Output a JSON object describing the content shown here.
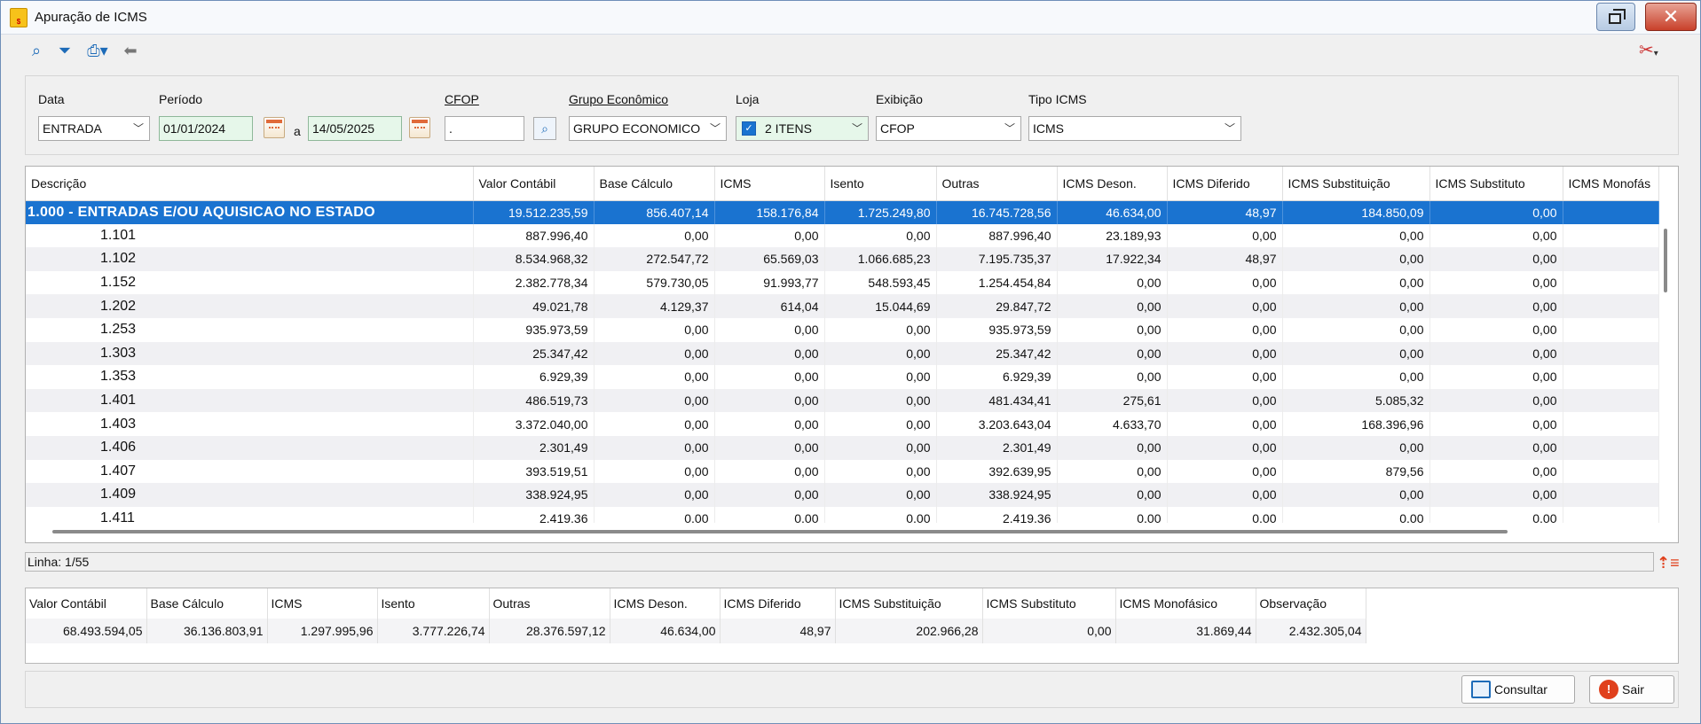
{
  "window": {
    "title": "Apuração de ICMS",
    "app_icon": "icms-app-icon",
    "restore_icon": "restore-icon",
    "close_icon": "close-icon"
  },
  "toolbar": {
    "icons": [
      "search-icon",
      "filter-icon",
      "print-icon",
      "back-arrow-icon"
    ],
    "tools_icon": "tools-icon"
  },
  "filters": {
    "data": {
      "label": "Data",
      "value": "ENTRADA"
    },
    "periodo": {
      "label": "Período",
      "start": "01/01/2024",
      "between": "a",
      "end": "14/05/2025"
    },
    "cfop": {
      "label": "CFOP",
      "value": "."
    },
    "grupo": {
      "label": "Grupo Econômico",
      "value": "GRUPO ECONOMICO"
    },
    "loja": {
      "label": "Loja",
      "value": "2 ITENS"
    },
    "exibicao": {
      "label": "Exibição",
      "value": "CFOP"
    },
    "tipo_icms": {
      "label": "Tipo ICMS",
      "value": "ICMS"
    }
  },
  "grid": {
    "columns": [
      "Descrição",
      "Valor Contábil",
      "Base Cálculo",
      "ICMS",
      "Isento",
      "Outras",
      "ICMS Deson.",
      "ICMS Diferido",
      "ICMS Substituição",
      "ICMS Substituto",
      "ICMS Monofás"
    ],
    "rows": [
      [
        "1.000 - ENTRADAS E/OU AQUISICAO NO ESTADO",
        "19.512.235,59",
        "856.407,14",
        "158.176,84",
        "1.725.249,80",
        "16.745.728,56",
        "46.634,00",
        "48,97",
        "184.850,09",
        "0,00",
        ""
      ],
      [
        "1.101",
        "887.996,40",
        "0,00",
        "0,00",
        "0,00",
        "887.996,40",
        "23.189,93",
        "0,00",
        "0,00",
        "0,00",
        ""
      ],
      [
        "1.102",
        "8.534.968,32",
        "272.547,72",
        "65.569,03",
        "1.066.685,23",
        "7.195.735,37",
        "17.922,34",
        "48,97",
        "0,00",
        "0,00",
        ""
      ],
      [
        "1.152",
        "2.382.778,34",
        "579.730,05",
        "91.993,77",
        "548.593,45",
        "1.254.454,84",
        "0,00",
        "0,00",
        "0,00",
        "0,00",
        ""
      ],
      [
        "1.202",
        "49.021,78",
        "4.129,37",
        "614,04",
        "15.044,69",
        "29.847,72",
        "0,00",
        "0,00",
        "0,00",
        "0,00",
        ""
      ],
      [
        "1.253",
        "935.973,59",
        "0,00",
        "0,00",
        "0,00",
        "935.973,59",
        "0,00",
        "0,00",
        "0,00",
        "0,00",
        ""
      ],
      [
        "1.303",
        "25.347,42",
        "0,00",
        "0,00",
        "0,00",
        "25.347,42",
        "0,00",
        "0,00",
        "0,00",
        "0,00",
        ""
      ],
      [
        "1.353",
        "6.929,39",
        "0,00",
        "0,00",
        "0,00",
        "6.929,39",
        "0,00",
        "0,00",
        "0,00",
        "0,00",
        ""
      ],
      [
        "1.401",
        "486.519,73",
        "0,00",
        "0,00",
        "0,00",
        "481.434,41",
        "275,61",
        "0,00",
        "5.085,32",
        "0,00",
        ""
      ],
      [
        "1.403",
        "3.372.040,00",
        "0,00",
        "0,00",
        "0,00",
        "3.203.643,04",
        "4.633,70",
        "0,00",
        "168.396,96",
        "0,00",
        ""
      ],
      [
        "1.406",
        "2.301,49",
        "0,00",
        "0,00",
        "0,00",
        "2.301,49",
        "0,00",
        "0,00",
        "0,00",
        "0,00",
        ""
      ],
      [
        "1.407",
        "393.519,51",
        "0,00",
        "0,00",
        "0,00",
        "392.639,95",
        "0,00",
        "0,00",
        "879,56",
        "0,00",
        ""
      ],
      [
        "1.409",
        "338.924,95",
        "0,00",
        "0,00",
        "0,00",
        "338.924,95",
        "0,00",
        "0,00",
        "0,00",
        "0,00",
        ""
      ],
      [
        "1.411",
        "2.419,36",
        "0,00",
        "0,00",
        "0,00",
        "2.419,36",
        "0,00",
        "0,00",
        "0,00",
        "0,00",
        ""
      ]
    ]
  },
  "status": {
    "line": "Linha: 1/55",
    "sort_icon": "sort-icon"
  },
  "totals": {
    "columns": [
      "Valor Contábil",
      "Base Cálculo",
      "ICMS",
      "Isento",
      "Outras",
      "ICMS Deson.",
      "ICMS Diferido",
      "ICMS Substituição",
      "ICMS Substituto",
      "ICMS Monofásico",
      "Observação"
    ],
    "values": [
      "68.493.594,05",
      "36.136.803,91",
      "1.297.995,96",
      "3.777.226,74",
      "28.376.597,12",
      "46.634,00",
      "48,97",
      "202.966,28",
      "0,00",
      "31.869,44",
      "2.432.305,04"
    ]
  },
  "buttons": {
    "consultar": "Consultar",
    "sair": "Sair"
  },
  "colors": {
    "selection": "#1a73d0",
    "accent": "#1d6bb8",
    "exit": "#e0401c"
  }
}
